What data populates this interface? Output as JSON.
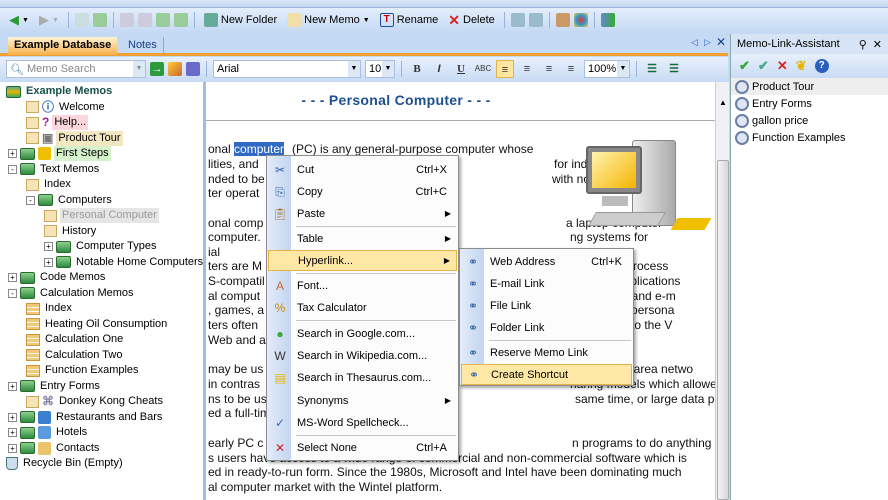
{
  "toolbar": {
    "new_folder": "New Folder",
    "new_memo": "New Memo",
    "rename": "Rename",
    "delete": "Delete"
  },
  "tabs": [
    {
      "label": "Example Database",
      "active": true
    },
    {
      "label": "Notes",
      "active": false
    }
  ],
  "format_bar": {
    "search_placeholder": "Memo Search",
    "font": "Arial",
    "size": "10",
    "bold": "B",
    "italic": "I",
    "underline": "U",
    "spell": "ABC",
    "zoom": "100%"
  },
  "tree": {
    "root": "Example Memos",
    "items": [
      "Welcome",
      "Help...",
      "Product Tour",
      "First Steps",
      "Text Memos",
      "Index",
      "Computers",
      "Personal Computer",
      "History",
      "Computer Types",
      "Notable Home Computers",
      "Code Memos",
      "Calculation Memos",
      "Index",
      "Heating Oil Consumption",
      "Calculation One",
      "Calculation Two",
      "Function Examples",
      "Entry Forms",
      "Donkey Kong Cheats",
      "Restaurants and Bars",
      "Hotels",
      "Contacts",
      "Recycle Bin (Empty)"
    ]
  },
  "editor": {
    "title": "- - -  Personal Computer  - - -",
    "selected_word": "computer",
    "lines": [
      {
        "l": "onal ",
        "r": "(PC) is any general-purpose computer whose"
      },
      {
        "l": "lities, and",
        "r": "for individuals, and"
      },
      {
        "l": "nded to be",
        "r": "with no intervening"
      },
      {
        "l": "ter operat",
        "r": ""
      },
      {
        "l": "onal comp",
        "r": "a laptop computer"
      },
      {
        "l": "computer.",
        "r": "ng systems for"
      },
      {
        "l": "ial",
        "r": ""
      },
      {
        "l": "ters are M",
        "r": "microprocess"
      },
      {
        "l": "S-compatil",
        "r": "e applications"
      },
      {
        "l": "al comput",
        "r": "wsers and e-m"
      },
      {
        "l": ", games, a",
        "r": "odern persona"
      },
      {
        "l": "ters often",
        "r": "ccess to the V"
      },
      {
        "l": "Web and a",
        "r": ""
      },
      {
        "l": "may be us",
        "r": "cal area netwo"
      },
      {
        "l": "in contras",
        "r": "haring models which allowed large expensive"
      },
      {
        "l": "ns to be us",
        "r": "same time, or large data processing systems"
      },
      {
        "l": "ed a full-tim",
        "r": ""
      },
      {
        "l": "early PC c",
        "r": "n programs to do anything useful with the ma"
      },
      {
        "l": "s users have access to a wide range of commercial and non-commercial software which is",
        "r": ""
      },
      {
        "l": "ed in ready-to-run form. Since the 1980s, Microsoft and Intel have been dominating much",
        "r": ""
      },
      {
        "l": "al computer market with the Wintel platform.",
        "r": ""
      }
    ]
  },
  "context_menu": [
    {
      "label": "Cut",
      "shortcut": "Ctrl+X",
      "icon": "scissors-icon"
    },
    {
      "label": "Copy",
      "shortcut": "Ctrl+C",
      "icon": "copy-icon"
    },
    {
      "label": "Paste",
      "shortcut": "",
      "icon": "paste-icon",
      "submenu": true
    },
    {
      "label": "Table",
      "shortcut": "",
      "icon": "",
      "submenu": true
    },
    {
      "label": "Hyperlink...",
      "shortcut": "",
      "icon": "",
      "submenu": true,
      "highlighted": true
    },
    {
      "label": "Font...",
      "shortcut": "",
      "icon": "font-icon"
    },
    {
      "label": "Tax Calculator",
      "shortcut": "",
      "icon": "calculator-icon"
    },
    {
      "label": "Search in Google.com...",
      "shortcut": "",
      "icon": "google-icon"
    },
    {
      "label": "Search in Wikipedia.com...",
      "shortcut": "",
      "icon": "wikipedia-icon"
    },
    {
      "label": "Search in Thesaurus.com...",
      "shortcut": "",
      "icon": "thesaurus-icon"
    },
    {
      "label": "Synonyms",
      "shortcut": "",
      "icon": "",
      "submenu": true
    },
    {
      "label": "MS-Word Spellcheck...",
      "shortcut": "",
      "icon": "spellcheck-icon"
    },
    {
      "label": "Select None",
      "shortcut": "Ctrl+A",
      "icon": "select-none-icon"
    }
  ],
  "submenu": [
    {
      "label": "Web Address",
      "shortcut": "Ctrl+K"
    },
    {
      "label": "E-mail Link",
      "shortcut": ""
    },
    {
      "label": "File Link",
      "shortcut": ""
    },
    {
      "label": "Folder Link",
      "shortcut": ""
    },
    {
      "label": "Reserve Memo Link",
      "shortcut": ""
    },
    {
      "label": "Create Shortcut",
      "shortcut": "",
      "highlighted": true
    }
  ],
  "right_panel": {
    "title": "Memo-Link-Assistant",
    "items": [
      "Product Tour",
      "Entry Forms",
      "gallon price",
      "Function Examples"
    ]
  },
  "colors": {
    "accent": "#f0a030",
    "highlight": "#ffe8a6",
    "title": "#1f4f90",
    "selection": "#316ac5"
  }
}
